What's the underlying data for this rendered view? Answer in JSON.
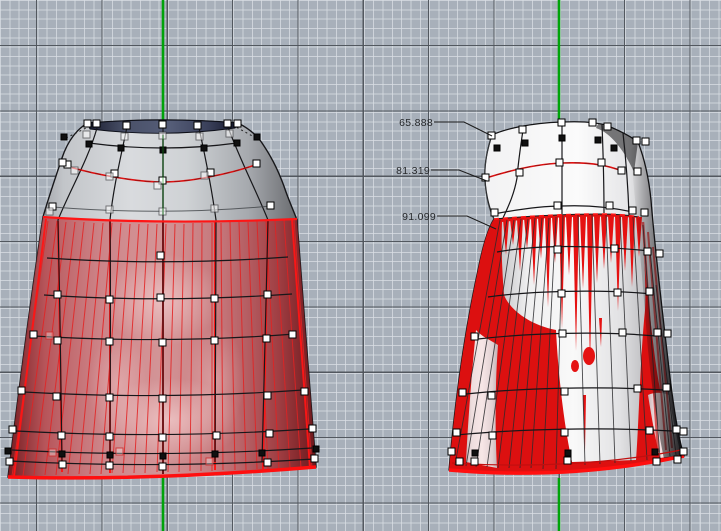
{
  "viewport": {
    "annotations": {
      "items": [
        {
          "value": "65.888"
        },
        {
          "value": "81.319"
        },
        {
          "value": "91.099"
        }
      ]
    },
    "colors": {
      "background": "#a8b0ba",
      "grid_minor": "#dadfe5",
      "grid_major": "#4e535a",
      "axis_green": "#00a30a",
      "selection_red": "#ff1515",
      "surface_red": "#d61212",
      "rim_navy": "#3f4663",
      "control_point_fill": "#ffffff",
      "control_point_border": "#000000"
    }
  }
}
